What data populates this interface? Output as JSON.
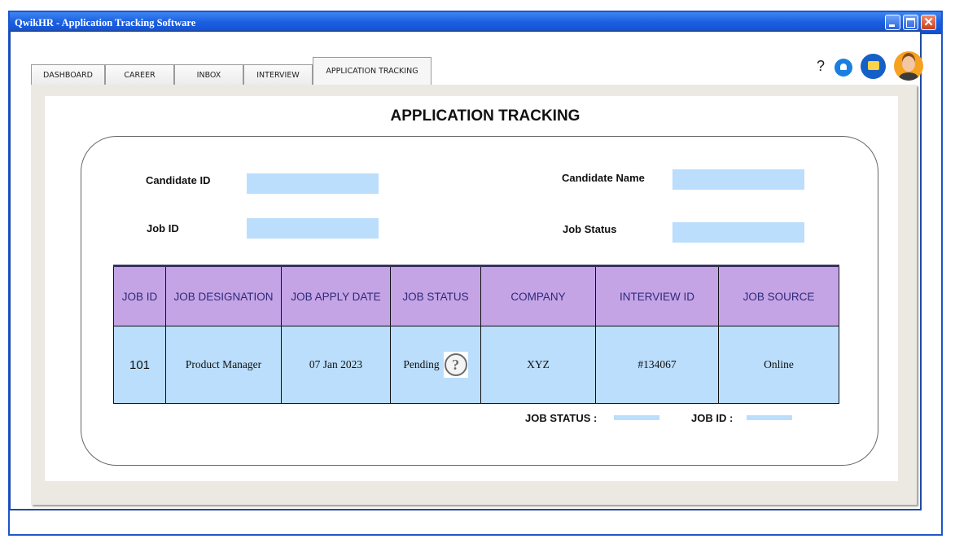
{
  "window": {
    "title": "QwikHR - Application Tracking Software",
    "close_glyph": "✕"
  },
  "tabs": [
    {
      "label": "DASHBOARD"
    },
    {
      "label": "CAREER"
    },
    {
      "label": "INBOX"
    },
    {
      "label": "INTERVIEW"
    },
    {
      "label": "APPLICATION TRACKING",
      "active": true
    }
  ],
  "header": {
    "help_label": "?"
  },
  "page": {
    "title": "APPLICATION TRACKING"
  },
  "form": {
    "candidate_id_label": "Candidate ID",
    "candidate_name_label": "Candidate Name",
    "job_id_label": "Job ID",
    "job_status_label": "Job Status",
    "candidate_id_value": "",
    "candidate_name_value": "",
    "job_id_value": "",
    "job_status_value": ""
  },
  "table": {
    "headers": [
      "JOB ID",
      "JOB DESIGNATION",
      "JOB APPLY DATE",
      "JOB STATUS",
      "COMPANY",
      "INTERVIEW ID",
      "JOB SOURCE"
    ],
    "rows": [
      {
        "job_id": "101",
        "designation": "Product Manager",
        "apply_date": "07 Jan 2023",
        "status": "Pending",
        "company": "XYZ",
        "interview_id": "#134067",
        "source": "Online"
      }
    ],
    "status_help_glyph": "?"
  },
  "footer": {
    "job_status_label": "JOB STATUS  :",
    "job_id_label": "JOB ID  :"
  },
  "colors": {
    "titlebar": "#1b5fe0",
    "header_fill": "#c5a4e6",
    "cell_fill": "#bbdefc",
    "field_fill": "#bbdefc"
  }
}
